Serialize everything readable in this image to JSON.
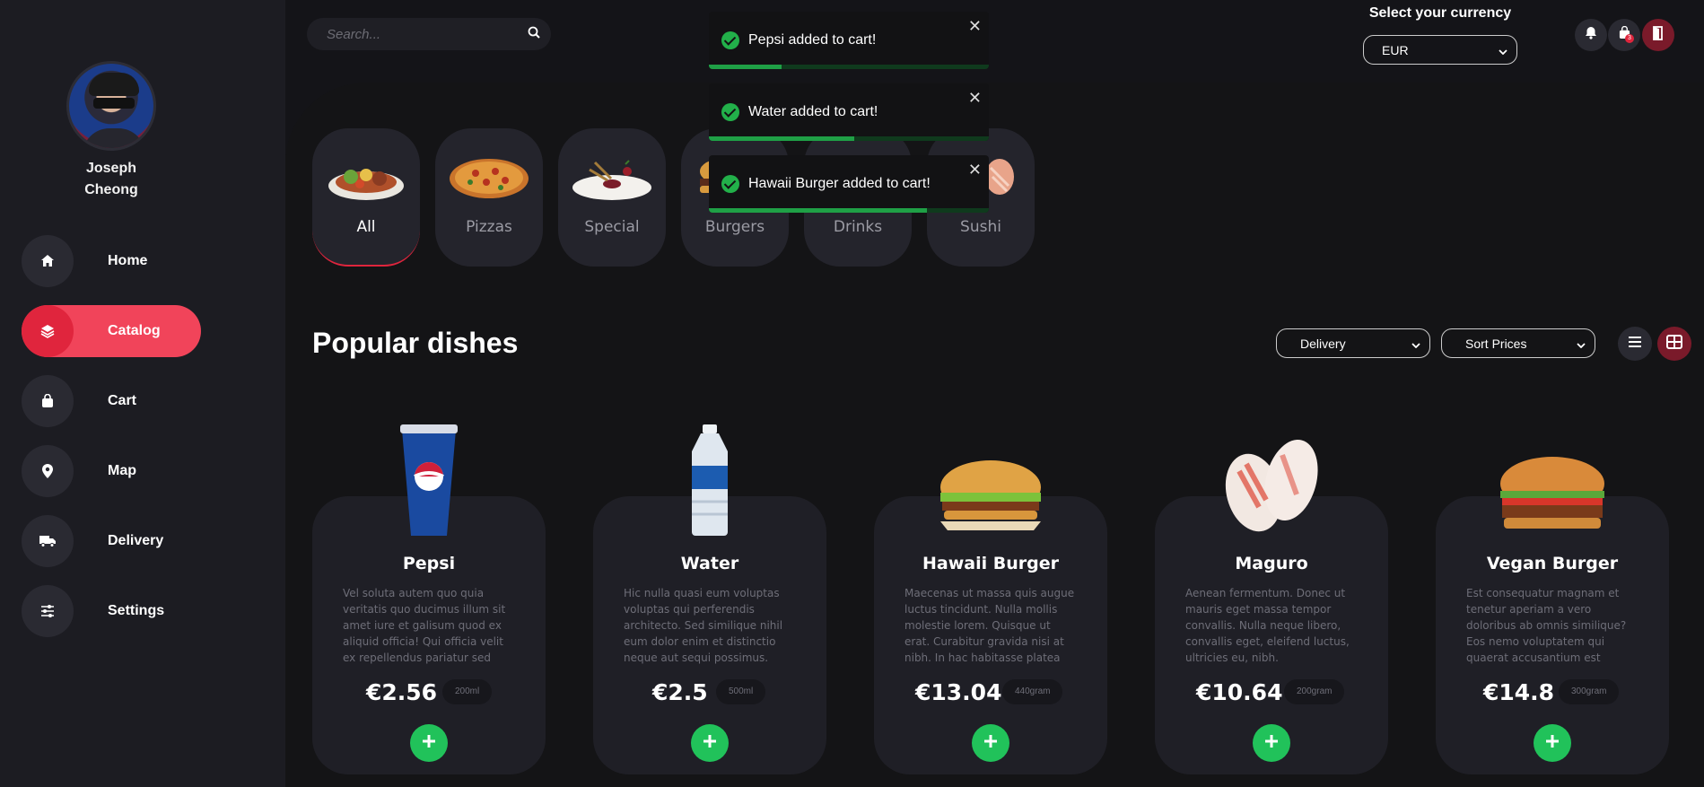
{
  "user": {
    "name": "Joseph Cheong"
  },
  "nav": [
    {
      "label": "Home",
      "icon": "home-icon"
    },
    {
      "label": "Catalog",
      "icon": "layers-icon",
      "active": true
    },
    {
      "label": "Cart",
      "icon": "bag-icon"
    },
    {
      "label": "Map",
      "icon": "map-pin-icon"
    },
    {
      "label": "Delivery",
      "icon": "truck-icon"
    },
    {
      "label": "Settings",
      "icon": "sliders-icon"
    }
  ],
  "search": {
    "placeholder": "Search..."
  },
  "currency": {
    "label": "Select your currency",
    "selected": "EUR"
  },
  "header_icons": {
    "cart_badge": "3"
  },
  "categories": [
    {
      "label": "All",
      "active": true
    },
    {
      "label": "Pizzas"
    },
    {
      "label": "Special"
    },
    {
      "label": "Burgers"
    },
    {
      "label": "Drinks"
    },
    {
      "label": "Sushi"
    }
  ],
  "toasts": [
    {
      "text": "Pepsi added to cart!",
      "close": "✕",
      "progress": 0.26
    },
    {
      "text": "Water added to cart!",
      "close": "✕",
      "progress": 0.52
    },
    {
      "text": "Hawaii Burger added to cart!",
      "close": "✕",
      "progress": 0.78
    }
  ],
  "section": {
    "title": "Popular dishes"
  },
  "filters": {
    "delivery": "Delivery",
    "sort": "Sort Prices"
  },
  "dishes": [
    {
      "name": "Pepsi",
      "description": "Vel soluta autem quo quia veritatis quo ducimus illum sit amet iure et galisum quod ex aliquid officia! Qui officia velit ex repellendus pariatur sed repellendus iusto!",
      "price": "€2.56",
      "size": "200ml"
    },
    {
      "name": "Water",
      "description": "Hic nulla quasi eum voluptas voluptas qui perferendis architecto. Sed similique nihil eum dolor enim et distinctio neque aut sequi possimus.",
      "price": "€2.5",
      "size": "500ml"
    },
    {
      "name": "Hawaii Burger",
      "description": "Maecenas ut massa quis augue luctus tincidunt. Nulla mollis molestie lorem. Quisque ut erat. Curabitur gravida nisi at nibh. In hac habitasse platea dictumst....",
      "price": "€13.04",
      "size": "440gram"
    },
    {
      "name": "Maguro",
      "description": "Aenean fermentum. Donec ut mauris eget massa tempor convallis. Nulla neque libero, convallis eget, eleifend luctus, ultricies eu, nibh.",
      "price": "€10.64",
      "size": "200gram"
    },
    {
      "name": "Vegan Burger",
      "description": "Est consequatur magnam et tenetur aperiam a vero doloribus ab omnis similique? Eos nemo voluptatem qui quaerat accusantium est voluptates aliqu...",
      "price": "€14.8",
      "size": "300gram"
    }
  ],
  "colors": {
    "accent": "#f1445a",
    "accent_dark": "#e0253d",
    "success": "#21c25a",
    "panel": "#1f1f26",
    "background": "#141416"
  }
}
